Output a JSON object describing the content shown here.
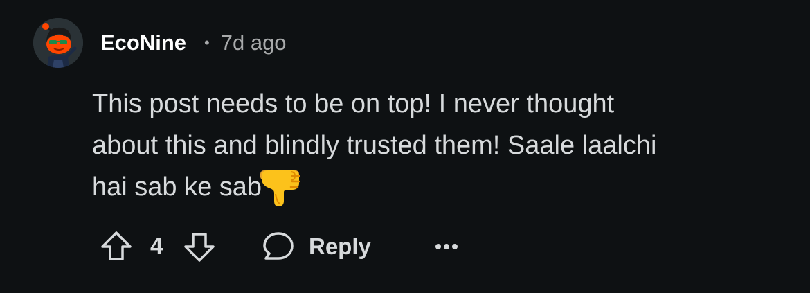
{
  "comment": {
    "author": "EcoNine",
    "separator": "•",
    "time": "7d ago",
    "text_line1": "This post needs to be on top! I never thought",
    "text_line2": "about this and blindly trusted them! Saale laalchi",
    "text_line3": "hai sab ke sab",
    "emoji": "thumbs-down-emoji"
  },
  "actions": {
    "vote_count": "4",
    "reply_label": "Reply",
    "upvote_icon": "arrow-up-icon",
    "downvote_icon": "arrow-down-icon",
    "reply_icon": "speech-bubble-icon",
    "more_icon": "ellipsis-icon"
  },
  "colors": {
    "background": "#0e1113",
    "username": "#ffffff",
    "text": "#d7dadc",
    "meta": "#a8aaab",
    "avatar_accent": "#ff4500"
  }
}
